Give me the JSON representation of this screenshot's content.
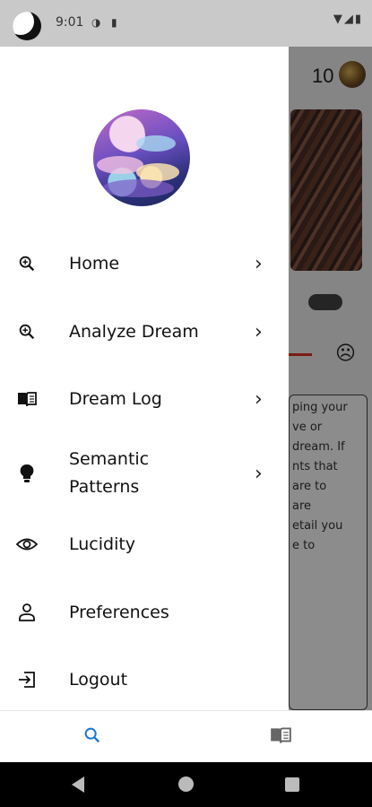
{
  "status_bar": {
    "time": "9:01"
  },
  "header": {
    "count": "10"
  },
  "background_card": {
    "text": "ping your\nve or\ndream. If\nnts that\nare to\nare\netail you\ne to"
  },
  "drawer": {
    "items": [
      {
        "label": "Home",
        "icon": "search-icon",
        "has_chevron": true
      },
      {
        "label": "Analyze Dream",
        "icon": "search-icon",
        "has_chevron": true
      },
      {
        "label": "Dream Log",
        "icon": "book-icon",
        "has_chevron": true
      },
      {
        "label": "Semantic\nPatterns",
        "icon": "lightbulb-icon",
        "has_chevron": true
      },
      {
        "label": "Lucidity",
        "icon": "eye-icon",
        "has_chevron": false
      },
      {
        "label": "Preferences",
        "icon": "person-icon",
        "has_chevron": false
      },
      {
        "label": "Logout",
        "icon": "logout-icon",
        "has_chevron": false
      }
    ]
  },
  "bottom_nav": {
    "active_color": "#1976d2",
    "items": [
      "search-icon",
      "book-icon"
    ]
  }
}
